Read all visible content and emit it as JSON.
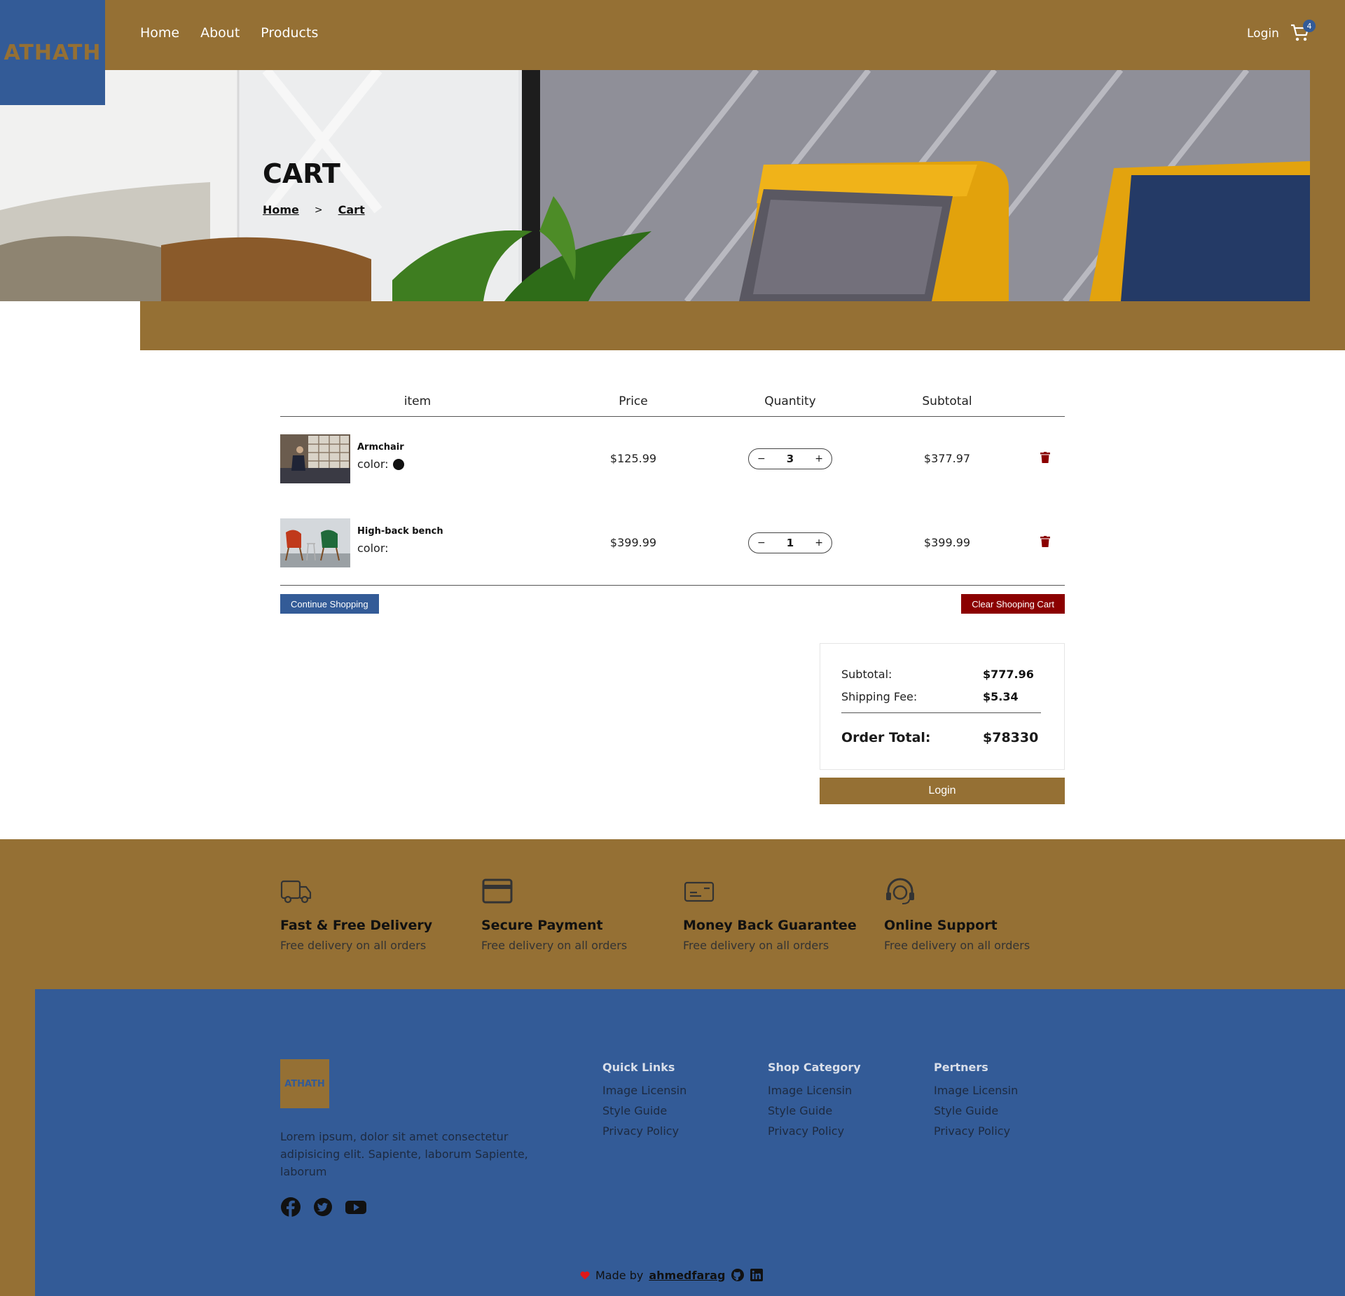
{
  "header": {
    "logo": "ATHATH",
    "nav": [
      "Home",
      "About",
      "Products"
    ],
    "login": "Login",
    "cart_count": "4"
  },
  "hero": {
    "title": "CART",
    "breadcrumb": [
      "Home",
      "Cart"
    ]
  },
  "cart": {
    "columns": [
      "item",
      "Price",
      "Quantity",
      "Subtotal"
    ],
    "items": [
      {
        "name": "Armchair",
        "color_label": "color:",
        "price": "$125.99",
        "quantity": "3",
        "subtotal": "$377.97"
      },
      {
        "name": "High-back bench",
        "color_label": "color:",
        "price": "$399.99",
        "quantity": "1",
        "subtotal": "$399.99"
      }
    ],
    "continue_label": "Continue Shopping",
    "clear_label": "Clear Shooping Cart"
  },
  "totals": {
    "subtotal_label": "Subtotal:",
    "subtotal_value": "$777.96",
    "shipping_label": "Shipping Fee:",
    "shipping_value": "$5.34",
    "order_total_label": "Order Total:",
    "order_total_value": "$78330",
    "login_label": "Login"
  },
  "services": [
    {
      "icon": "truck-icon",
      "title": "Fast & Free Delivery",
      "desc": "Free delivery on all orders"
    },
    {
      "icon": "credit-card-icon",
      "title": "Secure Payment",
      "desc": "Free delivery on all orders"
    },
    {
      "icon": "money-back-icon",
      "title": "Money Back Guarantee",
      "desc": "Free delivery on all orders"
    },
    {
      "icon": "headset-icon",
      "title": "Online Support",
      "desc": "Free delivery on all orders"
    }
  ],
  "footer": {
    "logo": "ATHATH",
    "about": "Lorem ipsum, dolor sit amet consectetur adipisicing elit. Sapiente, laborum Sapiente, laborum",
    "columns": [
      {
        "title": "Quick Links",
        "links": [
          "Image Licensin",
          "Style Guide",
          "Privacy Policy"
        ]
      },
      {
        "title": "Shop Category",
        "links": [
          "Image Licensin",
          "Style Guide",
          "Privacy Policy"
        ]
      },
      {
        "title": "Pertners",
        "links": [
          "Image Licensin",
          "Style Guide",
          "Privacy Policy"
        ]
      }
    ],
    "made_by_prefix": "Made by",
    "made_by_name": "ahmedfarag"
  },
  "colors": {
    "brand_gold": "#957034",
    "brand_blue": "#335b97",
    "danger": "#8b0000"
  }
}
